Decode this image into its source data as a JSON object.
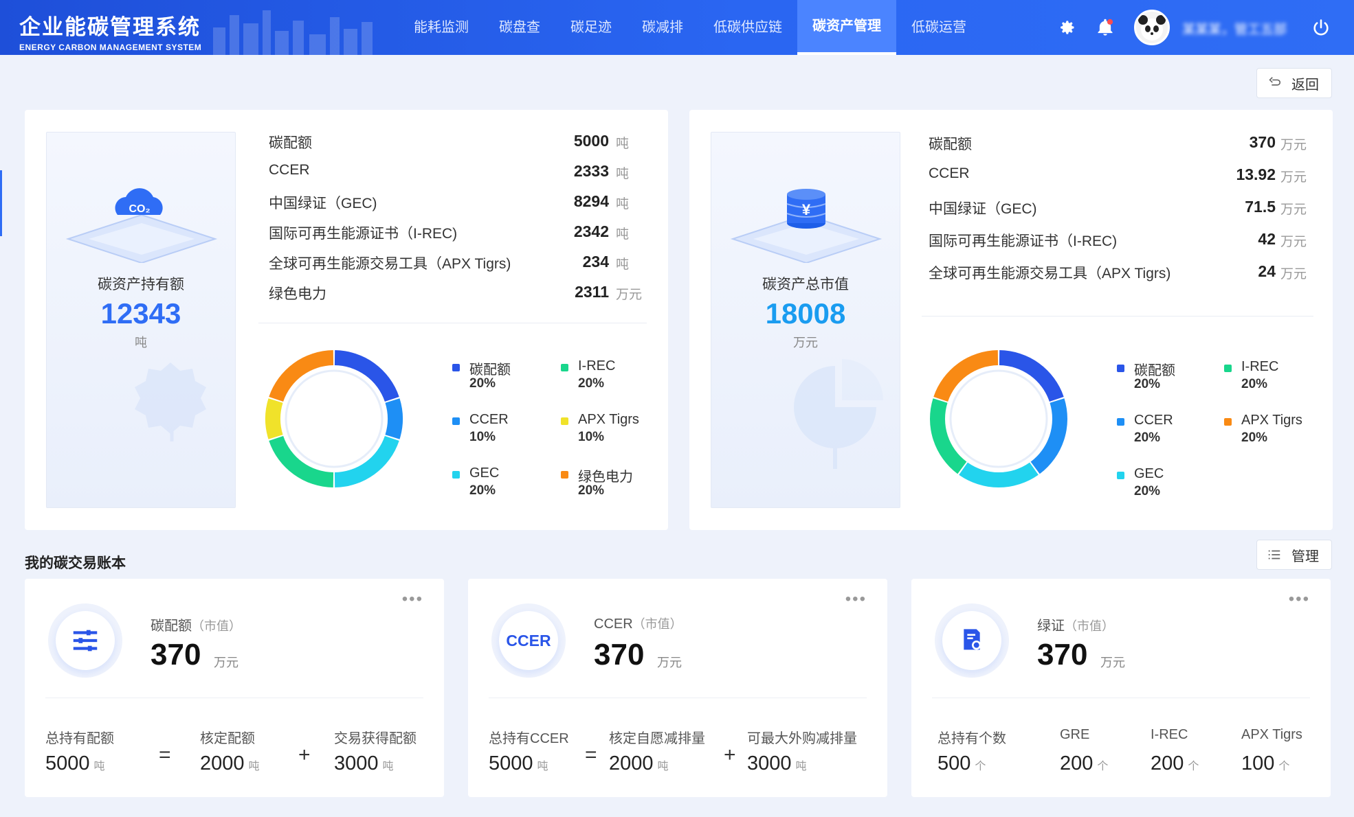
{
  "app": {
    "title": "企业能碳管理系统",
    "subtitle": "ENERGY CARBON MANAGEMENT SYSTEM",
    "user_name": "某某某，管工五部"
  },
  "nav": {
    "items": [
      {
        "label": "能耗监测"
      },
      {
        "label": "碳盘查"
      },
      {
        "label": "碳足迹"
      },
      {
        "label": "碳减排"
      },
      {
        "label": "低碳供应链"
      },
      {
        "label": "碳资产管理"
      },
      {
        "label": "低碳运营"
      }
    ],
    "active_index": 5
  },
  "actions": {
    "back_label": "返回",
    "manage_label": "管理"
  },
  "holdings": {
    "hero_label": "碳资产持有额",
    "hero_value": "12343",
    "hero_unit": "吨",
    "metrics": [
      {
        "name": "碳配额",
        "value": "5000",
        "unit": "吨"
      },
      {
        "name": "CCER",
        "value": "2333",
        "unit": "吨"
      },
      {
        "name": "中国绿证（GEC)",
        "value": "8294",
        "unit": "吨"
      },
      {
        "name": "国际可再生能源证书（I-REC)",
        "value": "2342",
        "unit": "吨"
      },
      {
        "name": "全球可再生能源交易工具（APX Tigrs)",
        "value": "234",
        "unit": "吨"
      },
      {
        "name": "绿色电力",
        "value": "2311",
        "unit": "万元"
      }
    ],
    "donut": [
      {
        "name": "碳配额",
        "pct": "20%",
        "value": 20,
        "color": "#2a55e8"
      },
      {
        "name": "I-REC",
        "pct": "20%",
        "value": 20,
        "color": "#19d68c"
      },
      {
        "name": "CCER",
        "pct": "10%",
        "value": 10,
        "color": "#1e8ff5"
      },
      {
        "name": "APX Tigrs",
        "pct": "10%",
        "value": 10,
        "color": "#f0e22a"
      },
      {
        "name": "GEC",
        "pct": "20%",
        "value": 20,
        "color": "#22d3ee"
      },
      {
        "name": "绿色电力",
        "pct": "20%",
        "value": 20,
        "color": "#f98a14"
      }
    ]
  },
  "market": {
    "hero_label": "碳资产总市值",
    "hero_value": "18008",
    "hero_unit": "万元",
    "metrics": [
      {
        "name": "碳配额",
        "value": "370",
        "unit": "万元"
      },
      {
        "name": "CCER",
        "value": "13.92",
        "unit": "万元"
      },
      {
        "name": "中国绿证（GEC)",
        "value": "71.5",
        "unit": "万元"
      },
      {
        "name": "国际可再生能源证书（I-REC)",
        "value": "42",
        "unit": "万元"
      },
      {
        "name": "全球可再生能源交易工具（APX Tigrs)",
        "value": "24",
        "unit": "万元"
      }
    ],
    "donut": [
      {
        "name": "碳配额",
        "pct": "20%",
        "value": 20,
        "color": "#2a55e8"
      },
      {
        "name": "I-REC",
        "pct": "20%",
        "value": 20,
        "color": "#19d68c"
      },
      {
        "name": "CCER",
        "pct": "20%",
        "value": 20,
        "color": "#1e8ff5"
      },
      {
        "name": "APX Tigrs",
        "pct": "20%",
        "value": 20,
        "color": "#f98a14"
      },
      {
        "name": "GEC",
        "pct": "20%",
        "value": 20,
        "color": "#22d3ee"
      }
    ]
  },
  "ledger": {
    "title": "我的碳交易账本",
    "cards": [
      {
        "title": "碳配额",
        "sub": "（市值）",
        "value": "370",
        "unit": "万元",
        "stats": [
          {
            "label": "总持有配额",
            "value": "5000",
            "unit": "吨"
          },
          {
            "label": "核定配额",
            "value": "2000",
            "unit": "吨"
          },
          {
            "label": "交易获得配额",
            "value": "3000",
            "unit": "吨"
          }
        ],
        "ops": [
          "=",
          "+"
        ]
      },
      {
        "title": "CCER",
        "sub": "（市值）",
        "value": "370",
        "unit": "万元",
        "icon_text": "CCER",
        "stats": [
          {
            "label": "总持有CCER",
            "value": "5000",
            "unit": "吨"
          },
          {
            "label": "核定自愿减排量",
            "value": "2000",
            "unit": "吨"
          },
          {
            "label": "可最大外购减排量",
            "value": "3000",
            "unit": "吨"
          }
        ],
        "ops": [
          "=",
          "+"
        ]
      },
      {
        "title": "绿证",
        "sub": "（市值）",
        "value": "370",
        "unit": "万元",
        "stats": [
          {
            "label": "总持有个数",
            "value": "500",
            "unit": "个"
          },
          {
            "label": "GRE",
            "value": "200",
            "unit": "个"
          },
          {
            "label": "I-REC",
            "value": "200",
            "unit": "个"
          },
          {
            "label": "APX Tigrs",
            "value": "100",
            "unit": "个"
          }
        ]
      }
    ]
  },
  "colors": {
    "primary": "#2f6df5",
    "header": "#2a66f2"
  }
}
